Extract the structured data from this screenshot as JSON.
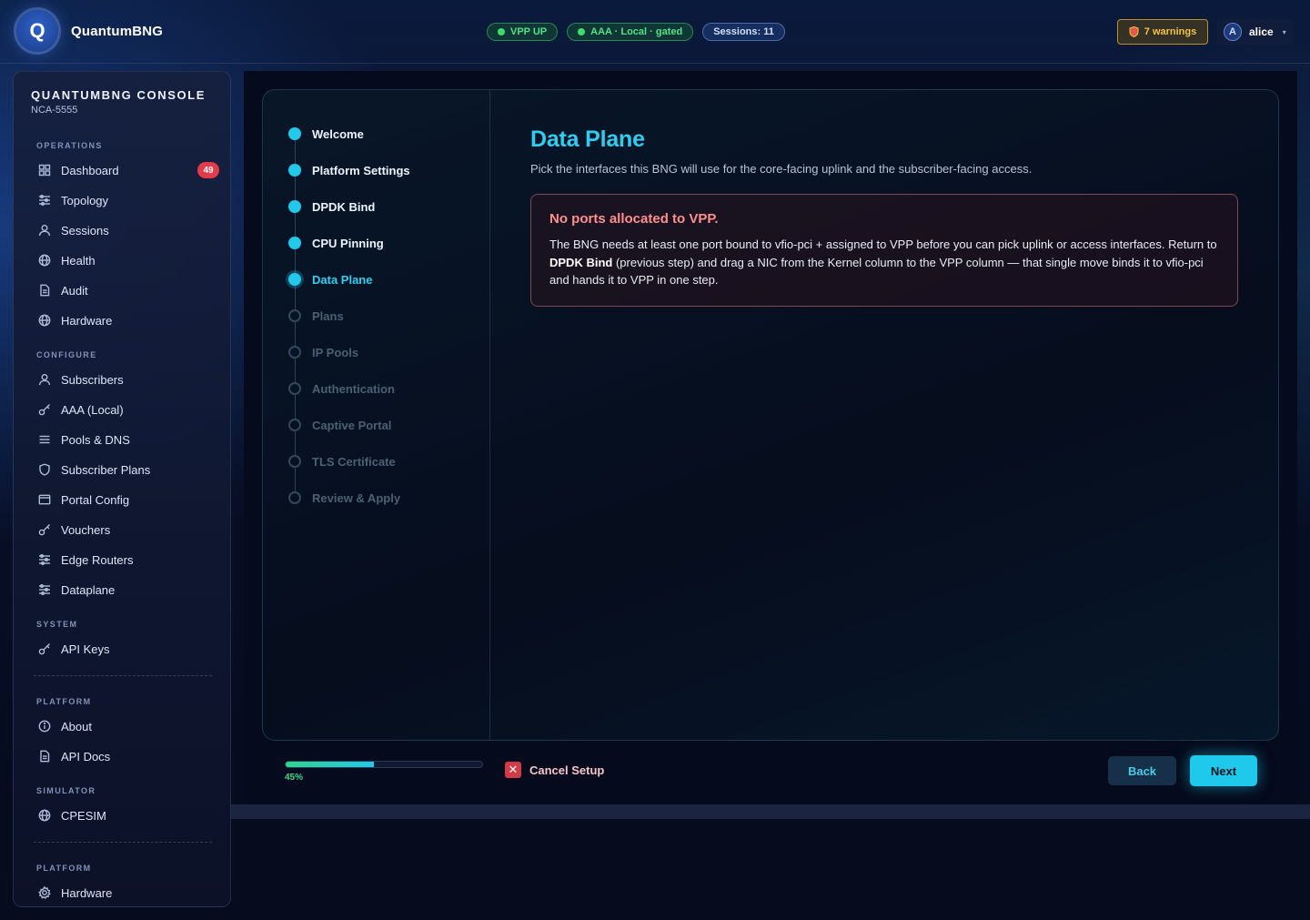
{
  "header": {
    "logo_letter": "Q",
    "brand": "QuantumBNG",
    "pills": [
      {
        "label": "VPP UP",
        "tone": "green",
        "dot": true
      },
      {
        "label": "AAA · Local · gated",
        "tone": "green",
        "dot": true
      },
      {
        "label": "Sessions: 11",
        "tone": "blue",
        "dot": false
      }
    ],
    "warnings": "7 warnings",
    "user": {
      "initial": "A",
      "name": "alice"
    }
  },
  "sidebar": {
    "title": "QUANTUMBNG CONSOLE",
    "subtitle": "NCA-5555",
    "sections": [
      {
        "label": "OPERATIONS",
        "items": [
          {
            "label": "Dashboard",
            "icon": "grid-icon",
            "badge": "49"
          },
          {
            "label": "Topology",
            "icon": "sliders-icon"
          },
          {
            "label": "Sessions",
            "icon": "user-icon"
          },
          {
            "label": "Health",
            "icon": "globe-icon"
          },
          {
            "label": "Audit",
            "icon": "document-icon"
          },
          {
            "label": "Hardware",
            "icon": "globe-icon"
          }
        ]
      },
      {
        "label": "CONFIGURE",
        "items": [
          {
            "label": "Subscribers",
            "icon": "user-icon"
          },
          {
            "label": "AAA (Local)",
            "icon": "key-icon"
          },
          {
            "label": "Pools & DNS",
            "icon": "list-icon"
          },
          {
            "label": "Subscriber Plans",
            "icon": "shield-icon"
          },
          {
            "label": "Portal Config",
            "icon": "window-icon"
          },
          {
            "label": "Vouchers",
            "icon": "key-icon"
          },
          {
            "label": "Edge Routers",
            "icon": "sliders-icon"
          },
          {
            "label": "Dataplane",
            "icon": "sliders-icon"
          }
        ]
      },
      {
        "label": "SYSTEM",
        "items": [
          {
            "label": "API Keys",
            "icon": "key-icon"
          }
        ]
      },
      {
        "label": "PLATFORM",
        "items": [
          {
            "label": "About",
            "icon": "info-icon"
          },
          {
            "label": "API Docs",
            "icon": "document-icon"
          }
        ]
      },
      {
        "label": "SIMULATOR",
        "items": [
          {
            "label": "CPESIM",
            "icon": "globe-icon"
          }
        ]
      },
      {
        "label": "PLATFORM",
        "items": [
          {
            "label": "Hardware",
            "icon": "gear-icon"
          }
        ]
      }
    ]
  },
  "wizard": {
    "steps": [
      {
        "label": "Welcome",
        "state": "done"
      },
      {
        "label": "Platform Settings",
        "state": "done"
      },
      {
        "label": "DPDK Bind",
        "state": "done"
      },
      {
        "label": "CPU Pinning",
        "state": "done"
      },
      {
        "label": "Data Plane",
        "state": "active"
      },
      {
        "label": "Plans",
        "state": "pending"
      },
      {
        "label": "IP Pools",
        "state": "pending"
      },
      {
        "label": "Authentication",
        "state": "pending"
      },
      {
        "label": "Captive Portal",
        "state": "pending"
      },
      {
        "label": "TLS Certificate",
        "state": "pending"
      },
      {
        "label": "Review & Apply",
        "state": "pending"
      }
    ],
    "title": "Data Plane",
    "subtitle": "Pick the interfaces this BNG will use for the core-facing uplink and the subscriber-facing access.",
    "alert": {
      "title": "No ports allocated to VPP.",
      "body_1": "The BNG needs at least one port bound to vfio-pci + assigned to VPP before you can pick uplink or access interfaces. Return to ",
      "body_bold": "DPDK Bind",
      "body_2": " (previous step) and drag a NIC from the Kernel column to the VPP column — that single move binds it to vfio-pci and hands it to VPP in one step."
    },
    "progress": {
      "percent": 45,
      "label": "45%"
    },
    "cancel_label": "Cancel Setup",
    "back_label": "Back",
    "next_label": "Next"
  },
  "colors": {
    "accent": "#22c9ea",
    "danger": "#d23b46",
    "success": "#3ddc6e",
    "warning": "#f2c24a"
  }
}
